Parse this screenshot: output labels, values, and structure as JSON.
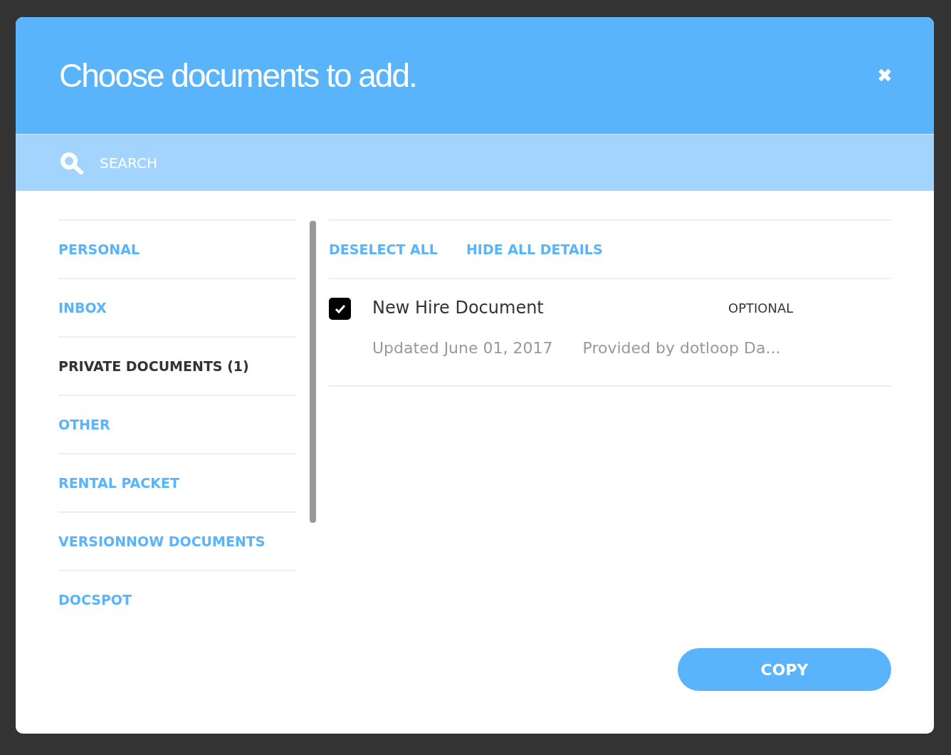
{
  "dialog": {
    "title": "Choose documents to add.",
    "close": "✖"
  },
  "search": {
    "placeholder": "SEARCH"
  },
  "folders": [
    {
      "label": "PERSONAL",
      "selected": false
    },
    {
      "label": "INBOX",
      "selected": false
    },
    {
      "label": "PRIVATE DOCUMENTS (1)",
      "selected": true
    },
    {
      "label": "OTHER",
      "selected": false
    },
    {
      "label": "RENTAL PACKET",
      "selected": false
    },
    {
      "label": "VERSIONNOW DOCUMENTS",
      "selected": false
    },
    {
      "label": "DOCSPOT",
      "selected": false
    }
  ],
  "actions": [
    "DESELECT ALL",
    "HIDE ALL DETAILS"
  ],
  "documents": [
    {
      "name": "New Hire Document",
      "tag": "OPTIONAL",
      "updated": "Updated June 01, 2017",
      "provider": "Provided by dotloop Da...",
      "checked": true
    }
  ],
  "primary_button": "COPY"
}
